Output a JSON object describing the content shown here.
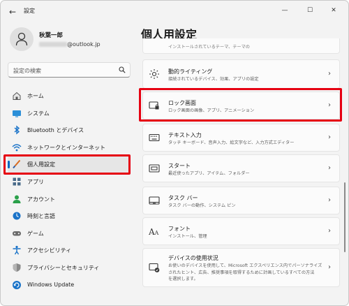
{
  "titlebar": {
    "app_title": "設定",
    "back": "←",
    "minimize": "—",
    "maximize": "☐",
    "close": "✕"
  },
  "user": {
    "name": "秋葉一郎",
    "email": "@outlook.jp"
  },
  "search": {
    "placeholder": "設定の検索"
  },
  "sidebar": {
    "items": [
      {
        "label": "ホーム",
        "icon": "home-icon"
      },
      {
        "label": "システム",
        "icon": "system-icon"
      },
      {
        "label": "Bluetooth とデバイス",
        "icon": "bluetooth-icon"
      },
      {
        "label": "ネットワークとインターネット",
        "icon": "wifi-icon"
      },
      {
        "label": "個人用設定",
        "icon": "brush-icon",
        "selected": true
      },
      {
        "label": "アプリ",
        "icon": "apps-icon"
      },
      {
        "label": "アカウント",
        "icon": "account-icon"
      },
      {
        "label": "時刻と言語",
        "icon": "clock-icon"
      },
      {
        "label": "ゲーム",
        "icon": "gamepad-icon"
      },
      {
        "label": "アクセシビリティ",
        "icon": "accessibility-icon"
      },
      {
        "label": "プライバシーとセキュリティ",
        "icon": "shield-icon"
      },
      {
        "label": "Windows Update",
        "icon": "update-icon"
      }
    ]
  },
  "main": {
    "title": "個人用設定",
    "partial_text": "インストールされているテーマ、テーマの",
    "cards": [
      {
        "title": "動的ライティング",
        "desc": "接続されているデバイス、効果、アプリの設定",
        "icon": "lighting-icon"
      },
      {
        "title": "ロック画面",
        "desc": "ロック画面の画像、アプリ、アニメーション",
        "icon": "lock-screen-icon"
      },
      {
        "title": "テキスト入力",
        "desc": "タッチ キーボード、音声入力、絵文字など、入力方式エディター",
        "icon": "keyboard-icon"
      },
      {
        "title": "スタート",
        "desc": "最近使ったアプリ、アイテム、フォルダー",
        "icon": "start-icon"
      },
      {
        "title": "タスク バー",
        "desc": "タスク バーの動作、システム ピン",
        "icon": "taskbar-icon"
      },
      {
        "title": "フォント",
        "desc": "インストール、管理",
        "icon": "font-icon"
      },
      {
        "title": "デバイスの使用状況",
        "desc_lines": [
          "お使いのデバイスを使用して、Microsoft エクスペリエンス内でパーソナライズ",
          "されたヒント、広告、推奨事項を取得するために計画しているすべての方法",
          "を選択します。"
        ],
        "icon": "device-usage-icon"
      }
    ]
  },
  "colors": {
    "accent": "#0067c0",
    "highlight": "#e60012"
  }
}
